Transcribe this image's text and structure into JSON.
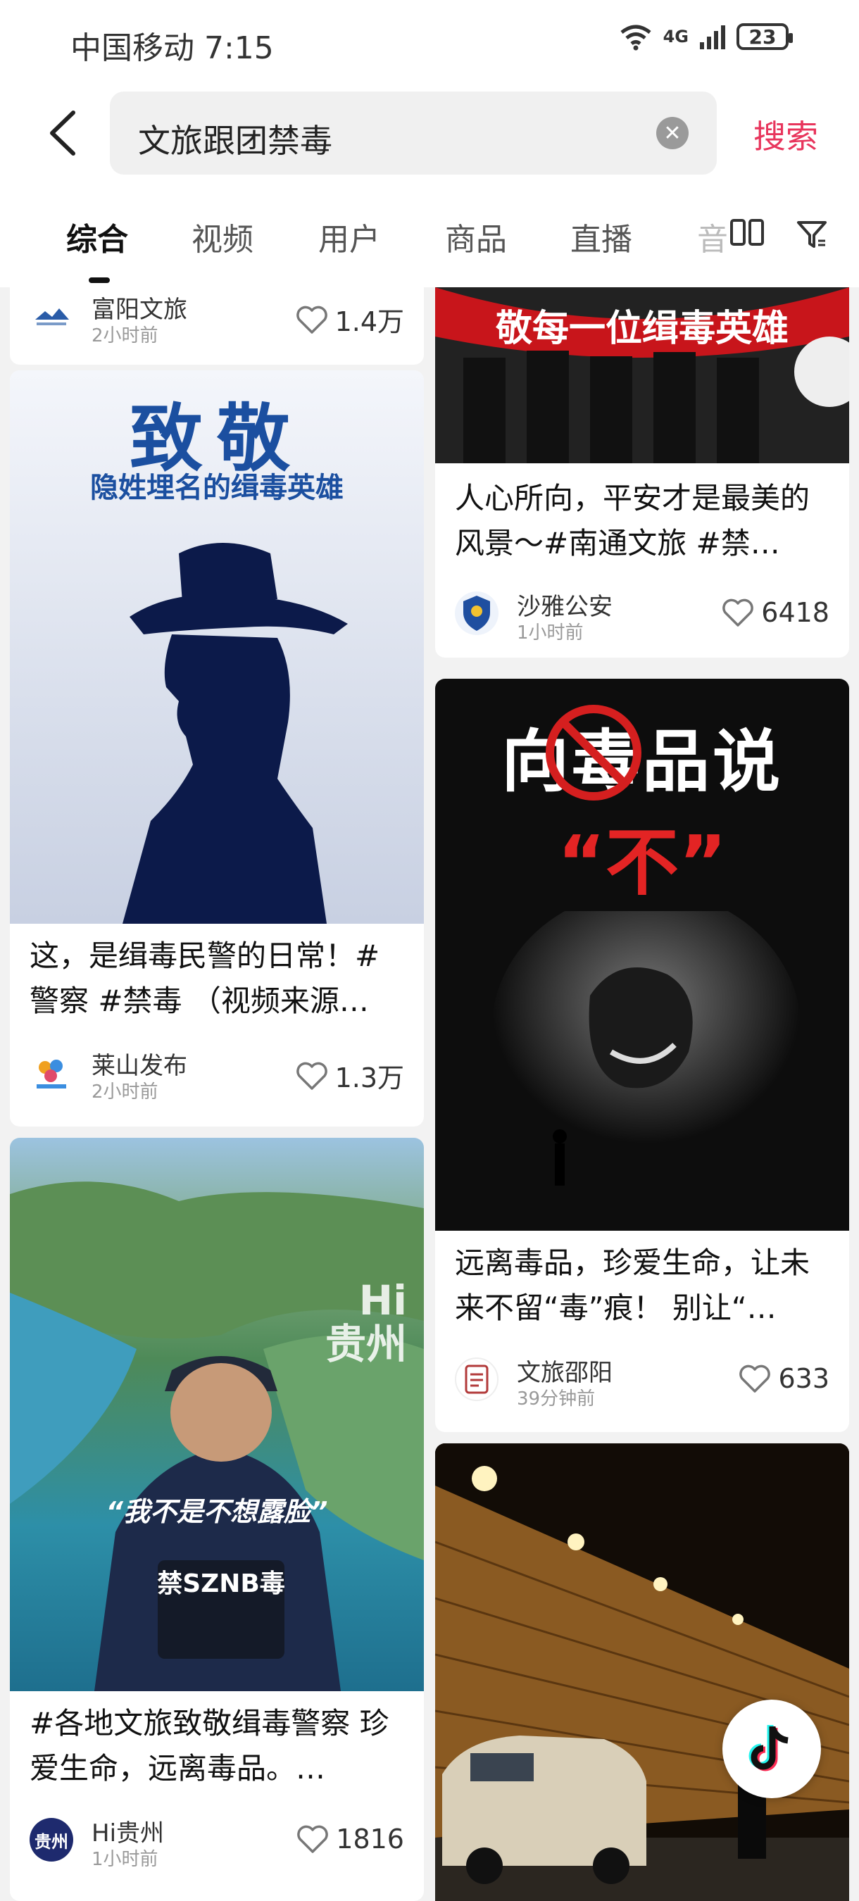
{
  "status_bar": {
    "carrier_time": "中国移动 7:15",
    "network": "4G",
    "battery": "23"
  },
  "search": {
    "query": "文旅跟团禁毒",
    "button": "搜索"
  },
  "tabs": [
    {
      "label": "综合",
      "active": true
    },
    {
      "label": "视频"
    },
    {
      "label": "用户"
    },
    {
      "label": "商品"
    },
    {
      "label": "直播"
    }
  ],
  "tab_overflow": "音",
  "cards": [
    {
      "author": "富阳文旅",
      "time": "2小时前",
      "likes": "1.4万"
    },
    {
      "banner": "敬每一位缉毒英雄",
      "title": "人心所向，平安才是最美的风景～#南通文旅 #禁…",
      "author": "沙雅公安",
      "time": "1小时前",
      "likes": "6418"
    },
    {
      "poster_title": "致敬",
      "poster_subtitle": "隐姓埋名的缉毒英雄",
      "title": "这，是缉毒民警的日常！#警察 #禁毒 （视频来源…",
      "author": "莱山发布",
      "time": "2小时前",
      "likes": "1.3万"
    },
    {
      "poster_title": "向毒品说",
      "poster_subtitle": "“不”",
      "title": "远离毒品，珍爱生命，让未来不留“毒”痕！ 别让“…",
      "author": "文旅邵阳",
      "time": "39分钟前",
      "likes": "633"
    },
    {
      "watermark": "Hi贵州",
      "caption": "“我不是不想露脸”",
      "vest": "禁SZNB毒",
      "title": "#各地文旅致敬缉毒警察 珍爱生命，远离毒品。…",
      "author": "Hi贵州",
      "avatar_text": "贵州",
      "time": "1小时前",
      "likes": "1816"
    }
  ]
}
